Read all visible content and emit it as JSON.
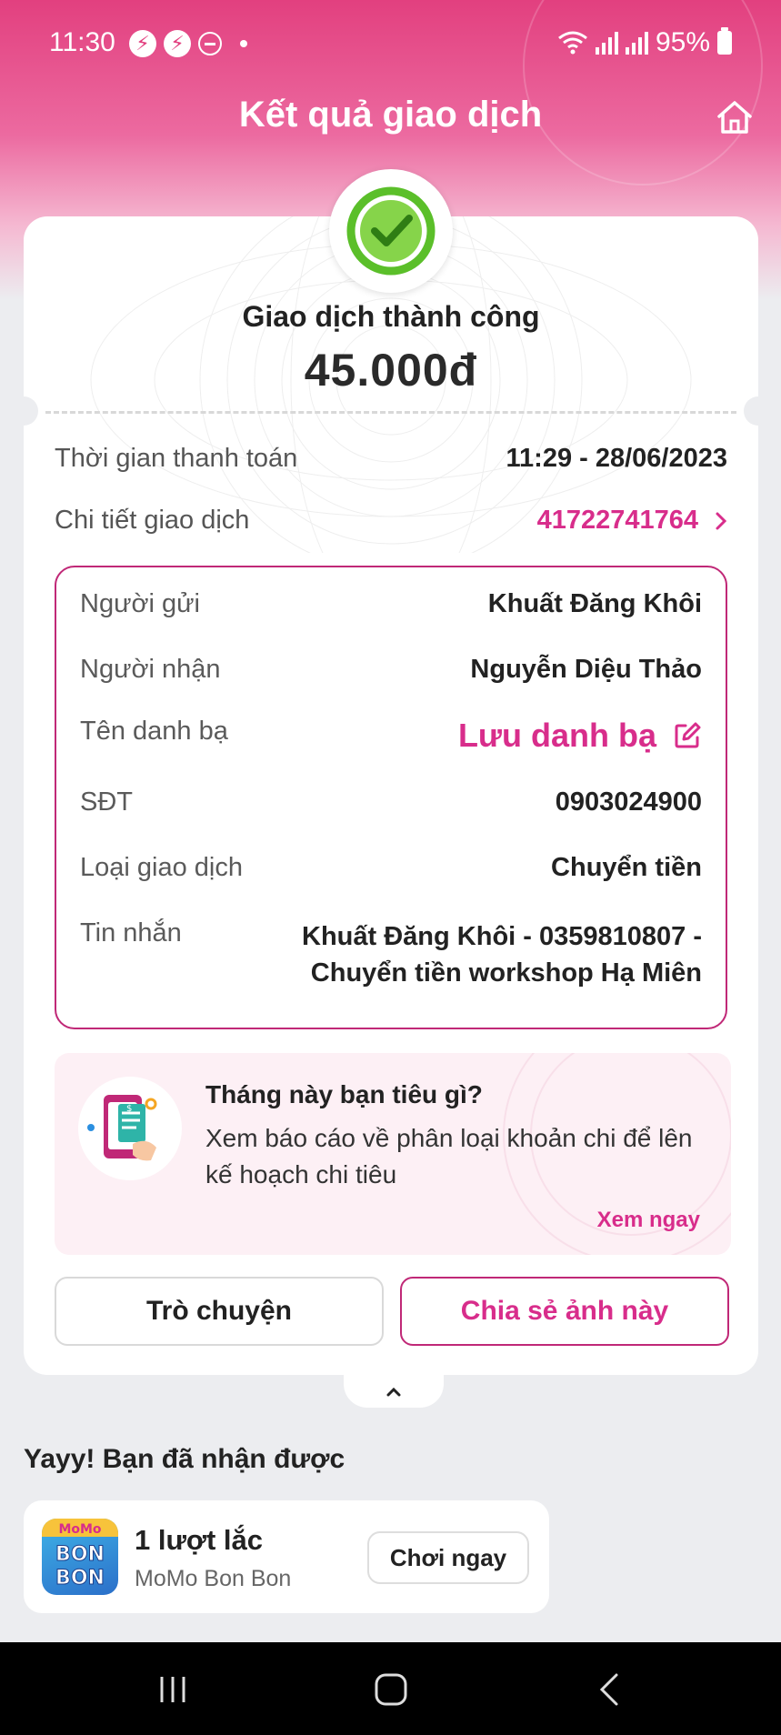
{
  "status_bar": {
    "time": "11:30",
    "battery": "95%",
    "icons": [
      "messenger-icon",
      "messenger-icon",
      "do-not-disturb-icon",
      "dot-icon",
      "wifi-icon",
      "signal-icon",
      "signal-icon",
      "battery-icon"
    ]
  },
  "header": {
    "title": "Kết quả giao dịch",
    "home_icon": "home-icon"
  },
  "summary": {
    "status_text": "Giao dịch thành công",
    "amount": "45.000đ",
    "status_icon": "check-circle-icon",
    "status_color": "#5bbf2a"
  },
  "payment_info": {
    "time_label": "Thời gian thanh toán",
    "time_value": "11:29 - 28/06/2023",
    "detail_label": "Chi tiết giao dịch",
    "detail_value": "41722741764"
  },
  "details": {
    "sender_label": "Người gửi",
    "sender_value": "Khuất Đăng Khôi",
    "receiver_label": "Người nhận",
    "receiver_value": "Nguyễn Diệu Thảo",
    "contact_label": "Tên danh bạ",
    "contact_action": "Lưu danh bạ",
    "phone_label": "SĐT",
    "phone_value": "0903024900",
    "type_label": "Loại giao dịch",
    "type_value": "Chuyển tiền",
    "message_label": "Tin nhắn",
    "message_line1": "Khuất Đăng Khôi - 0359810807 -",
    "message_line2": "Chuyển tiền workshop Hạ Miên"
  },
  "promo": {
    "title": "Tháng này bạn tiêu gì?",
    "description": "Xem báo cáo về phân loại khoản chi để lên kế hoạch chi tiêu",
    "link": "Xem ngay"
  },
  "actions": {
    "chat": "Trò chuyện",
    "share": "Chia sẻ ảnh này"
  },
  "reward": {
    "heading": "Yayy! Bạn đã nhận được",
    "title": "1 lượt lắc",
    "subtitle": "MoMo Bon Bon",
    "button": "Chơi ngay",
    "logo_text_top": "MoMo",
    "logo_text_mid": "BON",
    "logo_text_bot": "BON"
  },
  "colors": {
    "brand": "#d82d8b",
    "border": "#c02877",
    "success": "#5bbf2a"
  }
}
